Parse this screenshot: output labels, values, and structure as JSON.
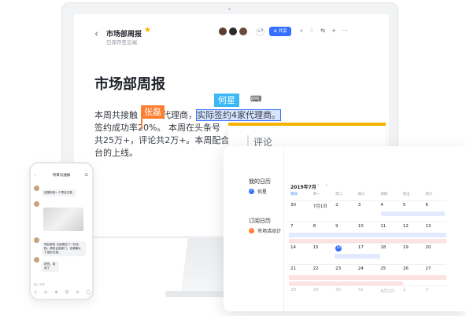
{
  "doc": {
    "back_icon": "chevron-left-icon",
    "title_small": "市场部周报",
    "star_glyph": "★",
    "saved_status": "已保存至云端",
    "avatar_count": "+7",
    "share_label": "共享",
    "tool_icons": [
      "search-icon",
      "bell-icon",
      "sliders-icon",
      "add-icon",
      "more-icon"
    ],
    "tool_glyphs": [
      "⌕",
      "♢",
      "⇆",
      "+",
      "···"
    ],
    "heading": "市场部周报",
    "line1_a": "本周共接触",
    "line1_b": "在代理商，",
    "line1_sel": "实际签约4家代理商。",
    "line2": "签约成功率20%。 本周在头条号",
    "line3": "共25万+，评论共2万+。本周配合",
    "line4": "台的上线。",
    "cursor_tag_orange": "张磊",
    "cursor_tag_blue": "何星",
    "comment_icon": "⌨",
    "comment_label": "评论"
  },
  "phone": {
    "title": "项目沟通群",
    "back": "‹",
    "menu": "☰",
    "msg1": "这是你的一个项目文档",
    "msg2": "项目资料 已经提交了一份文档，请发往各部门，也请确认下这份文档。",
    "msg3": "好的，收到了",
    "input_placeholder": "输入消息",
    "bottom_icons": [
      "○",
      "◎",
      "⊕",
      "☺",
      "⊖",
      "◯"
    ]
  },
  "calendar": {
    "my_calendar": "我的日历",
    "my_item": "何星",
    "sub_calendar": "订阅日历",
    "sub_item": "市场活动计",
    "month_label": "2019年7月",
    "nav_prev": "‹",
    "nav_next": "›",
    "weekdays": [
      "周日",
      "周一",
      "周二",
      "周三",
      "周四",
      "周五",
      "周六"
    ],
    "weeks": [
      [
        "30",
        "7月1日",
        "2",
        "3",
        "4",
        "5",
        "6"
      ],
      [
        "7",
        "8",
        "9",
        "10",
        "11",
        "12",
        "13"
      ],
      [
        "14",
        "15",
        "16",
        "17",
        "18",
        "19",
        "20"
      ],
      [
        "21",
        "22",
        "23",
        "24",
        "25",
        "26",
        "27"
      ],
      [
        "28",
        "29",
        "30",
        "31",
        "8月1日",
        "2",
        "3"
      ]
    ],
    "colors": {
      "accent": "#3370ff",
      "orange": "#ff7d2e",
      "pink": "#fde2e2",
      "blue_band": "#e1eaff"
    }
  }
}
